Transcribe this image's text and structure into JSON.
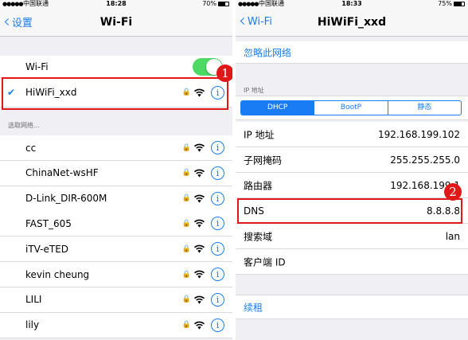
{
  "left": {
    "status": {
      "signal": "●●●●●",
      "carrier": "中国联通",
      "time": "18:28",
      "battery": "70%",
      "battery_level": 0.7
    },
    "nav": {
      "back_label": "设置",
      "title": "Wi-Fi"
    },
    "wifi_label": "Wi-Fi",
    "wifi_on": true,
    "connected": {
      "name": "HiWiFi_xxd"
    },
    "section_header": "选取网络...",
    "networks": [
      {
        "name": "cc"
      },
      {
        "name": "ChinaNet-wsHF"
      },
      {
        "name": "D-Link_DIR-600M"
      },
      {
        "name": "FAST_605"
      },
      {
        "name": "iTV-eTED"
      },
      {
        "name": "kevin cheung"
      },
      {
        "name": "LILI"
      },
      {
        "name": "lily"
      }
    ],
    "badge": "1"
  },
  "right": {
    "status": {
      "signal": "●●●●●",
      "carrier": "中国联通",
      "time": "18:33",
      "battery": "75%",
      "battery_level": 0.75
    },
    "nav": {
      "back_label": "Wi-Fi",
      "title": "HiWiFi_xxd"
    },
    "forget": "忽略此网络",
    "ip_header": "IP 地址",
    "segments": [
      "DHCP",
      "BootP",
      "静态"
    ],
    "rows": [
      {
        "key": "IP 地址",
        "value": "192.168.199.102"
      },
      {
        "key": "子网掩码",
        "value": "255.255.255.0"
      },
      {
        "key": "路由器",
        "value": "192.168.199.1"
      },
      {
        "key": "DNS",
        "value": "8.8.8.8"
      },
      {
        "key": "搜索域",
        "value": "lan"
      },
      {
        "key": "客户端 ID",
        "value": ""
      }
    ],
    "renew": "续租",
    "badge": "2"
  },
  "colors": {
    "accent": "#1a7cf5",
    "highlight": "#e01818",
    "toggle_on": "#4cd964"
  }
}
